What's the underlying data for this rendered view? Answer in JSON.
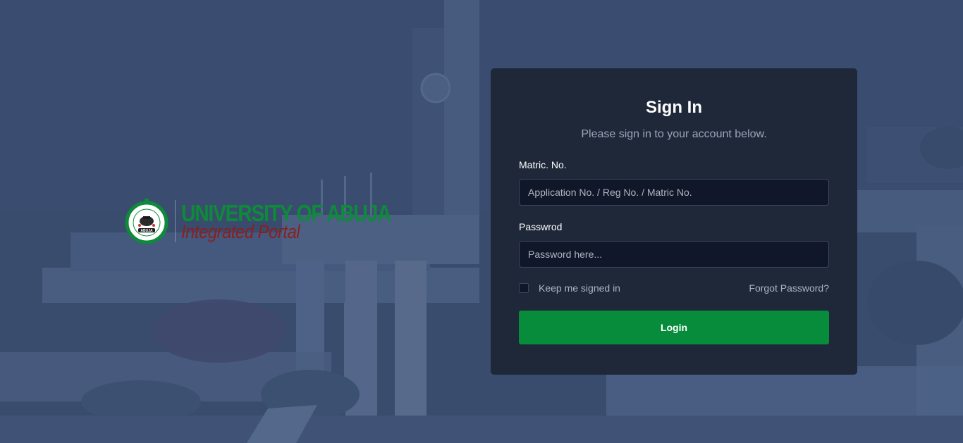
{
  "brand": {
    "university": "UNIVERSITY OF ABUJA",
    "portal": "Integrated Portal",
    "seal_text": "ABUJA"
  },
  "signin": {
    "title": "Sign In",
    "subtitle": "Please sign in to your account below.",
    "matric_label": "Matric. No.",
    "matric_placeholder": "Application No. / Reg No. / Matric No.",
    "password_label": "Passwrod",
    "password_placeholder": "Password here...",
    "keep_signed_in": "Keep me signed in",
    "forgot_password": "Forgot Password?",
    "login_button": "Login"
  },
  "colors": {
    "background_overlay": "#3f5170",
    "card": "#1e2839",
    "login_button": "#078c3c",
    "brand_green": "#0d8a3a",
    "brand_red": "#8a1f1f"
  }
}
